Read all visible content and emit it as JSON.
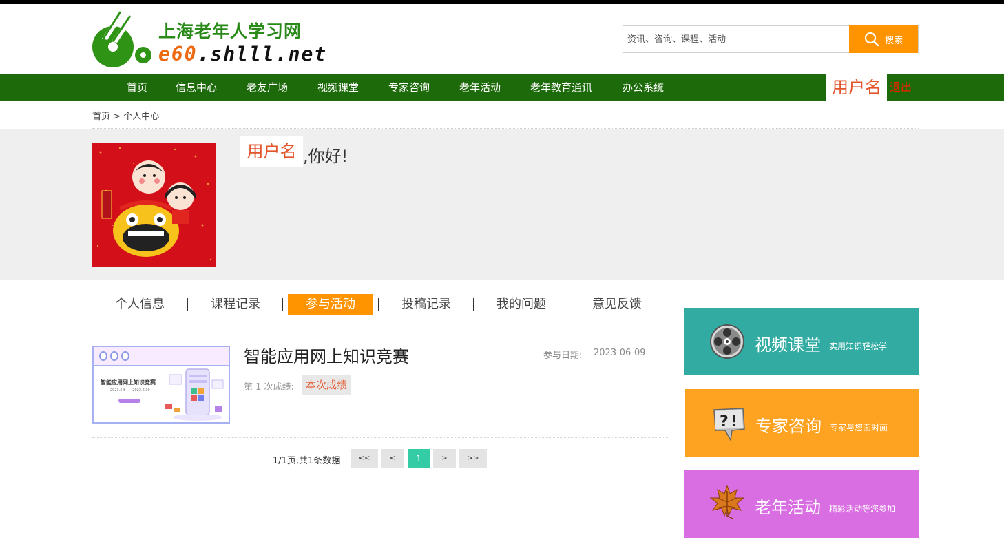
{
  "site": {
    "title": "上海老年人学习网",
    "domain_prefix": "e60",
    "domain_rest": ".shlll.net"
  },
  "search": {
    "placeholder": "资讯、咨询、课程、活动",
    "button_label": "搜索"
  },
  "nav": {
    "items": [
      "首页",
      "信息中心",
      "老友广场",
      "视频课堂",
      "专家咨询",
      "老年活动",
      "老年教育通讯",
      "办公系统"
    ],
    "username": "用户名",
    "logout_label": "退出"
  },
  "breadcrumb": {
    "home": "首页",
    "separator": " > ",
    "current": "个人中心"
  },
  "profile": {
    "username": "用户名",
    "greeting": ",你好!"
  },
  "tabs": [
    {
      "label": "个人信息",
      "active": false
    },
    {
      "label": "课程记录",
      "active": false
    },
    {
      "label": "参与活动",
      "active": true
    },
    {
      "label": "投稿记录",
      "active": false
    },
    {
      "label": "我的问题",
      "active": false
    },
    {
      "label": "意见反馈",
      "active": false
    }
  ],
  "activity": {
    "title": "智能应用网上知识竞赛",
    "thumbnail_title": "智能应用网上知识竞赛",
    "thumbnail_date": "2023.5.8——2023.6.30",
    "join_label": "参与日期:",
    "join_date": "2023-06-09",
    "attempt_label": "第 1 次成绩:",
    "score_label": "本次成绩"
  },
  "pagination": {
    "summary": "1/1页,共1条数据",
    "first": "<<",
    "prev": "<",
    "current": "1",
    "next": ">",
    "last": ">>"
  },
  "side_cards": [
    {
      "title": "视频课堂",
      "subtitle": "实用知识轻松学",
      "color": "#32aca2",
      "icon": "film-reel-icon"
    },
    {
      "title": "专家咨询",
      "subtitle": "专家与您面对面",
      "color": "#fea221",
      "icon": "question-bubble-icon"
    },
    {
      "title": "老年活动",
      "subtitle": "精彩活动等您参加",
      "color": "#d96ee3",
      "icon": "maple-leaf-icon"
    }
  ],
  "colors": {
    "nav_green": "#1c6a0a",
    "accent_orange": "#ff9400",
    "username_red": "#e2542a",
    "page_current": "#33cca5"
  }
}
